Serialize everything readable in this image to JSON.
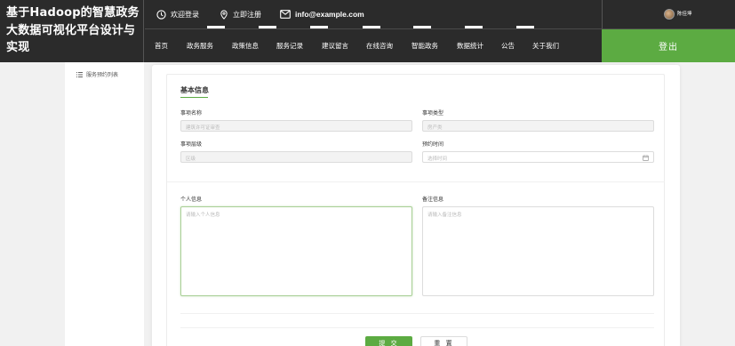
{
  "header": {
    "brand_lines": [
      "基于Hadoop的智慧政务",
      "大数据可视化平台设计与",
      "实现"
    ],
    "top_links": {
      "login": "欢迎登录",
      "register": "立即注册",
      "email": "info@example.com"
    },
    "nav": [
      "首页",
      "政务服务",
      "政策信息",
      "服务记录",
      "建议留言",
      "在线咨询",
      "智能政务",
      "数据统计",
      "公告",
      "关于我们"
    ],
    "username": "陈佳坤",
    "logout": "登出"
  },
  "sidebar": {
    "items": [
      {
        "label": "服务预约列表",
        "icon": "list-icon"
      }
    ]
  },
  "form": {
    "section_title": "基本信息",
    "fields": {
      "item_name": {
        "label": "事项名称",
        "value": "建筑许可证审查"
      },
      "item_type": {
        "label": "事项类型",
        "value": "房产类"
      },
      "item_level": {
        "label": "事项层级",
        "value": "区级"
      },
      "appointment_time": {
        "label": "预约时间",
        "placeholder": "选择时间"
      },
      "personal_info": {
        "label": "个人信息",
        "placeholder": "请输入个人信息"
      },
      "remark_info": {
        "label": "备注信息",
        "placeholder": "请输入备注信息"
      }
    },
    "buttons": {
      "submit": "提 交",
      "reset": "重 置"
    }
  },
  "colors": {
    "header_bg": "#2b2b2b",
    "accent": "#5cab42",
    "page_bg": "#f1f1f1"
  }
}
